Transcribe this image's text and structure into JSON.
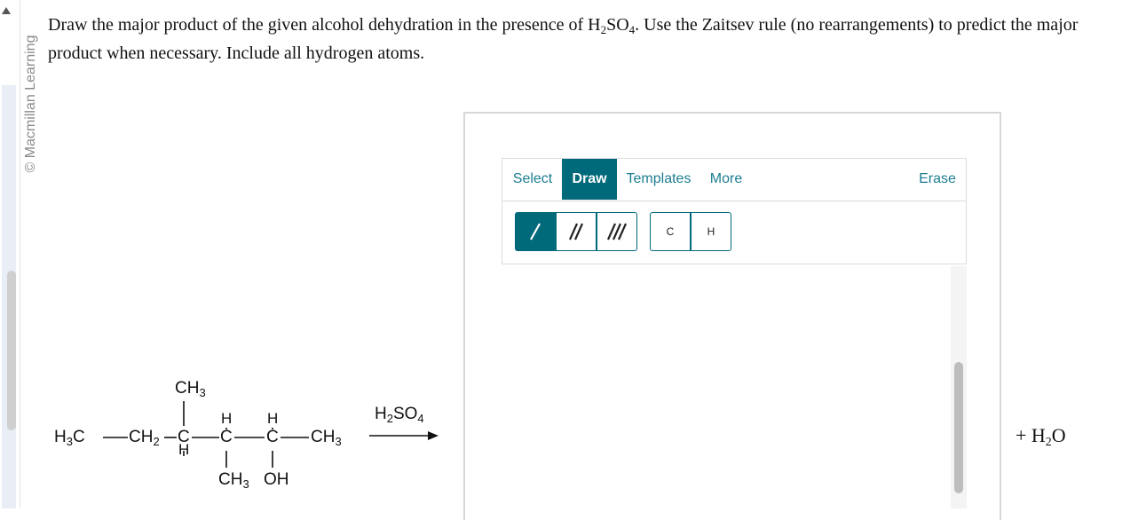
{
  "brand": {
    "text": "© Macmillan Learning"
  },
  "question": {
    "part1": "Draw the major product of the given alcohol dehydration in the presence of H",
    "sub1": "2",
    "part2": "SO",
    "sub2": "4",
    "part3": ". Use the Zaitsev rule (no rearrangements) to predict the major product when necessary. Include all hydrogen atoms."
  },
  "toolbar": {
    "tabs": [
      "Select",
      "Draw",
      "Templates",
      "More"
    ],
    "active_tab": "Draw",
    "erase_label": "Erase",
    "tools": [
      {
        "icon": "single-bond-icon",
        "active": true
      },
      {
        "icon": "double-bond-icon",
        "active": false
      },
      {
        "icon": "triple-bond-icon",
        "active": false
      },
      {
        "label": "C",
        "icon": "carbon-atom-icon",
        "active": false
      },
      {
        "label": "H",
        "icon": "hydrogen-atom-icon",
        "active": false
      }
    ]
  },
  "reactant": {
    "atoms": {
      "h3c": "H",
      "h3c_sub": "3",
      "h3c_c": "C",
      "ch2": "CH",
      "ch2_sub": "2",
      "c1": "C",
      "c2": "C",
      "c3": "C",
      "ch3_end": "CH",
      "ch3_end_sub": "3",
      "ch3_top": "CH",
      "ch3_top_sub": "3",
      "h_c1": "H",
      "h_c2": "H",
      "h_c3": "H",
      "ch3_bottom": "CH",
      "ch3_bottom_sub": "3",
      "oh": "OH"
    }
  },
  "reagent": {
    "h": "H",
    "h_sub": "2",
    "so": "SO",
    "so_sub": "4"
  },
  "byproduct": {
    "plus": "+ H",
    "sub": "2",
    "o": "O"
  },
  "colors": {
    "accent": "#00697a",
    "tab_text": "#1d7d91"
  }
}
